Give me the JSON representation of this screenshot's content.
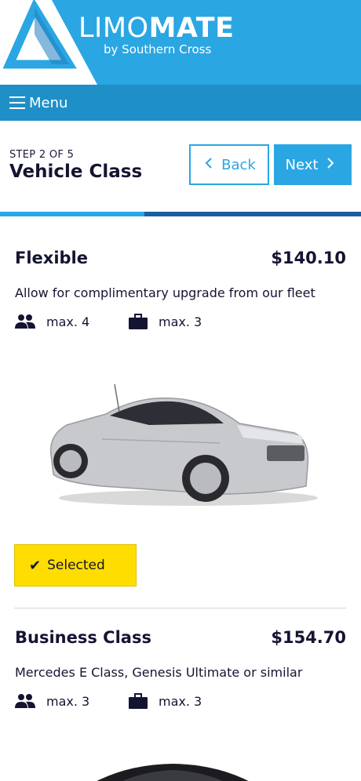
{
  "header": {
    "brand_light": "LIMO",
    "brand_bold": "MATE",
    "brand_sub": "by Southern Cross",
    "logo_icon": "triangle-logo-icon",
    "colors": {
      "primary": "#2aa6e3",
      "dark": "#1f8fc8",
      "accent": "#ffdd00"
    }
  },
  "menu": {
    "label": "Menu",
    "icon": "hamburger-icon"
  },
  "step": {
    "label": "STEP 2 OF 5",
    "title": "Vehicle Class",
    "back_label": "Back",
    "next_label": "Next",
    "progress": 0.4
  },
  "vehicles": [
    {
      "name": "Flexible",
      "price": "$140.10",
      "description": "Allow for complimentary upgrade from our fleet",
      "passengers": "max. 4",
      "luggage": "max. 3",
      "selected_label": "Selected"
    },
    {
      "name": "Business Class",
      "price": "$154.70",
      "description": "Mercedes E Class, Genesis Ultimate or similar",
      "passengers": "max. 3",
      "luggage": "max. 3"
    }
  ]
}
